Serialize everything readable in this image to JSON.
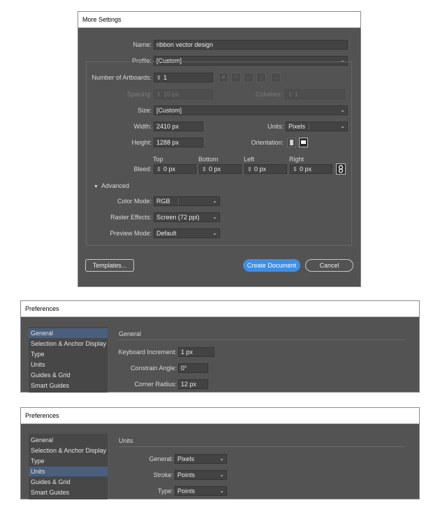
{
  "more_settings": {
    "title": "More Settings",
    "name_label": "Name:",
    "name_value": "ribbon vector design",
    "profile_label": "Profile:",
    "profile_value": "[Custom]",
    "artboards_label": "Number of Artboards:",
    "artboards_value": "1",
    "spacing_label": "Spacing:",
    "spacing_value": "20 px",
    "columns_label": "Columns:",
    "columns_value": "1",
    "size_label": "Size:",
    "size_value": "[Custom]",
    "width_label": "Width:",
    "width_value": "2410 px",
    "units_label": "Units:",
    "units_value": "Pixels",
    "height_label": "Height:",
    "height_value": "1288 px",
    "orientation_label": "Orientation:",
    "bleed_label": "Bleed:",
    "bleed": [
      {
        "label": "Top",
        "value": "0 px"
      },
      {
        "label": "Bottom",
        "value": "0 px"
      },
      {
        "label": "Left",
        "value": "0 px"
      },
      {
        "label": "Right",
        "value": "0 px"
      }
    ],
    "advanced_label": "Advanced",
    "color_mode_label": "Color Mode:",
    "color_mode_value": "RGB",
    "raster_label": "Raster Effects:",
    "raster_value": "Screen (72 ppi)",
    "preview_label": "Preview Mode:",
    "preview_value": "Default",
    "templates_button": "Templates...",
    "create_button": "Create Document",
    "cancel_button": "Cancel"
  },
  "preferences_general": {
    "title": "Preferences",
    "sidebar": [
      "General",
      "Selection & Anchor Display",
      "Type",
      "Units",
      "Guides & Grid",
      "Smart Guides"
    ],
    "selected_index": 0,
    "section_title": "General",
    "fields": [
      {
        "label": "Keyboard Increment:",
        "value": "1 px"
      },
      {
        "label": "Constrain Angle:",
        "value": "0°"
      },
      {
        "label": "Corner Radius:",
        "value": "12 px"
      }
    ]
  },
  "preferences_units": {
    "title": "Preferences",
    "sidebar": [
      "General",
      "Selection & Anchor Display",
      "Type",
      "Units",
      "Guides & Grid",
      "Smart Guides"
    ],
    "selected_index": 3,
    "section_title": "Units",
    "fields": [
      {
        "label": "General:",
        "value": "Pixels"
      },
      {
        "label": "Stroke:",
        "value": "Points"
      },
      {
        "label": "Type:",
        "value": "Points"
      }
    ]
  },
  "colors": {
    "panel": "#535353",
    "field": "#434343",
    "accent": "#3f8ee6",
    "selection": "#4a5f7e"
  },
  "icons": [
    "chevron-down-icon",
    "spinner-arrows-icon",
    "grid-by-row-icon",
    "arrange-by-row-icon",
    "link-icon",
    "portrait-icon",
    "landscape-icon",
    "triangle-down-icon"
  ]
}
